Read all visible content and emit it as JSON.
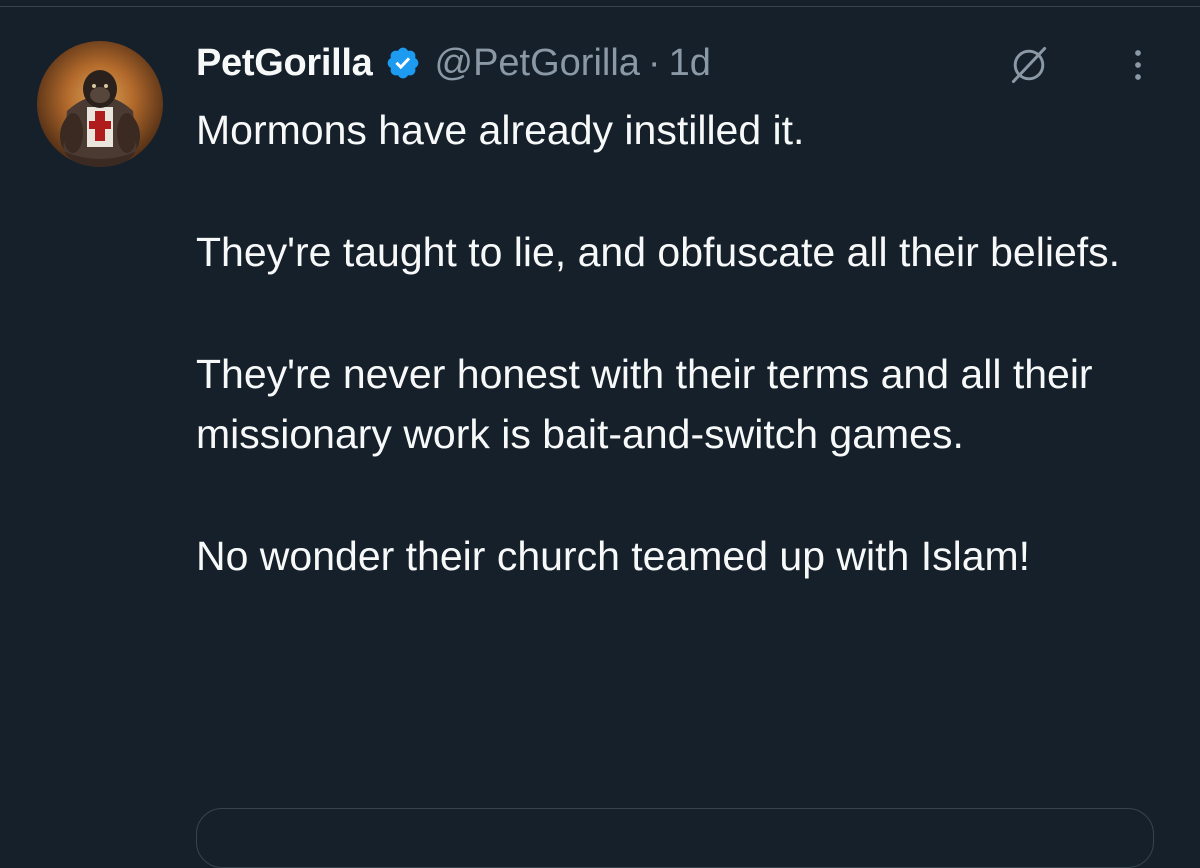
{
  "tweet": {
    "display_name": "PetGorilla",
    "handle": "@PetGorilla",
    "separator": "·",
    "time": "1d",
    "paragraphs": [
      "Mormons have already instilled it.",
      "They're taught to lie, and obfuscate all their beliefs.",
      "They're never honest with their terms and all their missionary work is bait-and-switch games.",
      "No wonder their church teamed up with Islam!"
    ]
  },
  "icons": {
    "avatar": "gorilla-avatar",
    "verified": "verified-badge-icon",
    "grok": "grok-icon",
    "more": "more-options-icon"
  },
  "colors": {
    "background": "#15202b",
    "text_primary": "#f7f9f9",
    "text_secondary": "#8b98a5",
    "verified_blue": "#1d9bf0",
    "border": "#38444d"
  }
}
